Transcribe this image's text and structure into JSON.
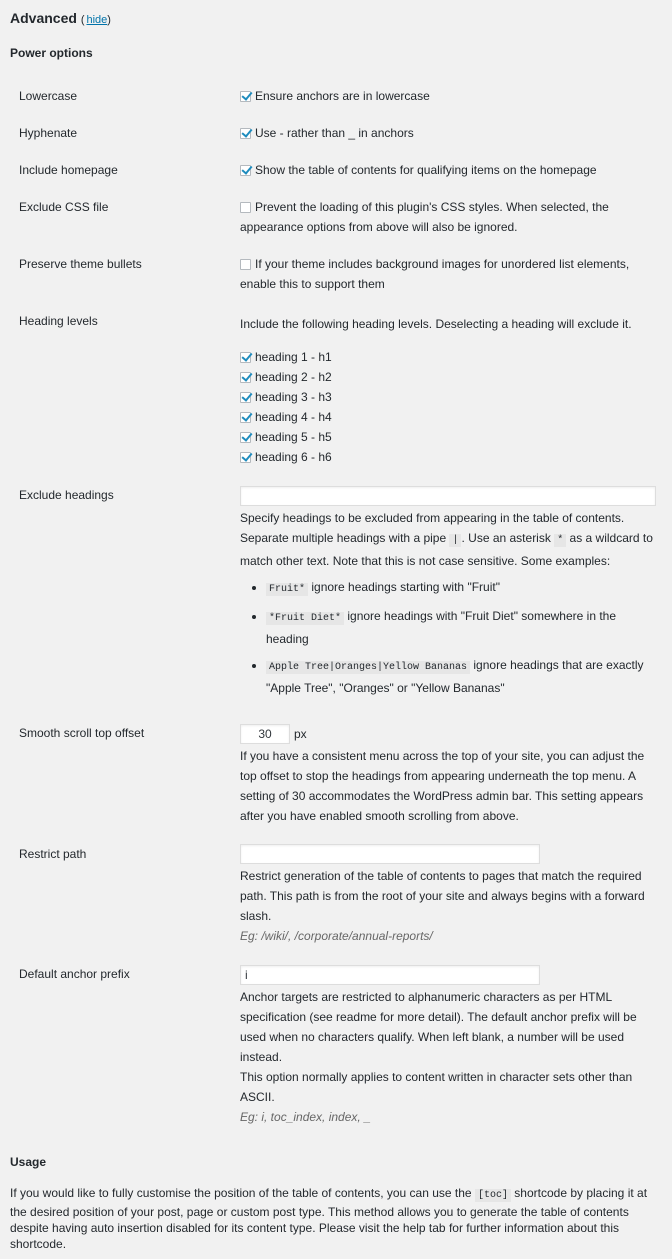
{
  "header": {
    "title": "Advanced",
    "hide_link": "hide"
  },
  "power_options": {
    "heading": "Power options",
    "lowercase": {
      "label": "Lowercase",
      "checked": true,
      "text": "Ensure anchors are in lowercase"
    },
    "hyphenate": {
      "label": "Hyphenate",
      "checked": true,
      "text": "Use - rather than _ in anchors"
    },
    "include_homepage": {
      "label": "Include homepage",
      "checked": true,
      "text": "Show the table of contents for qualifying items on the homepage"
    },
    "exclude_css": {
      "label": "Exclude CSS file",
      "checked": false,
      "text": "Prevent the loading of this plugin's CSS styles. When selected, the appearance options from above will also be ignored."
    },
    "preserve_bullets": {
      "label": "Preserve theme bullets",
      "checked": false,
      "text": "If your theme includes background images for unordered list elements, enable this to support them"
    },
    "heading_levels": {
      "label": "Heading levels",
      "intro": "Include the following heading levels. Deselecting a heading will exclude it.",
      "items": [
        {
          "label": "heading 1 - h1",
          "checked": true
        },
        {
          "label": "heading 2 - h2",
          "checked": true
        },
        {
          "label": "heading 3 - h3",
          "checked": true
        },
        {
          "label": "heading 4 - h4",
          "checked": true
        },
        {
          "label": "heading 5 - h5",
          "checked": true
        },
        {
          "label": "heading 6 - h6",
          "checked": true
        }
      ]
    },
    "exclude_headings": {
      "label": "Exclude headings",
      "value": "",
      "desc_1": "Specify headings to be excluded from appearing in the table of contents. Separate multiple headings with a pipe ",
      "pipe": "|",
      "desc_2": ". Use an asterisk ",
      "asterisk": "*",
      "desc_3": " as a wildcard to match other text. Note that this is not case sensitive. Some examples:",
      "examples": [
        {
          "code": "Fruit*",
          "text": " ignore headings starting with \"Fruit\""
        },
        {
          "code": "*Fruit Diet*",
          "text": " ignore headings with \"Fruit Diet\" somewhere in the heading"
        },
        {
          "code": "Apple Tree|Oranges|Yellow Bananas",
          "text": " ignore headings that are exactly \"Apple Tree\", \"Oranges\" or \"Yellow Bananas\""
        }
      ]
    },
    "smooth_scroll": {
      "label": "Smooth scroll top offset",
      "value": "30",
      "unit": "px",
      "desc": "If you have a consistent menu across the top of your site, you can adjust the top offset to stop the headings from appearing underneath the top menu. A setting of 30 accommodates the WordPress admin bar. This setting appears after you have enabled smooth scrolling from above."
    },
    "restrict_path": {
      "label": "Restrict path",
      "value": "",
      "desc": "Restrict generation of the table of contents to pages that match the required path. This path is from the root of your site and always begins with a forward slash.",
      "eg": "Eg: /wiki/, /corporate/annual-reports/"
    },
    "anchor_prefix": {
      "label": "Default anchor prefix",
      "value": "i",
      "desc_1": "Anchor targets are restricted to alphanumeric characters as per HTML specification (see readme for more detail). The default anchor prefix will be used when no characters qualify. When left blank, a number will be used instead.",
      "desc_2": "This option normally applies to content written in character sets other than ASCII.",
      "eg": "Eg: i, toc_index, index, _"
    }
  },
  "usage": {
    "heading": "Usage",
    "text_1": "If you would like to fully customise the position of the table of contents, you can use the ",
    "code": "[toc]",
    "text_2": " shortcode by placing it at the desired position of your post, page or custom post type. This method allows you to generate the table of contents despite having auto insertion disabled for its content type. Please visit the help tab for further information about this shortcode."
  }
}
